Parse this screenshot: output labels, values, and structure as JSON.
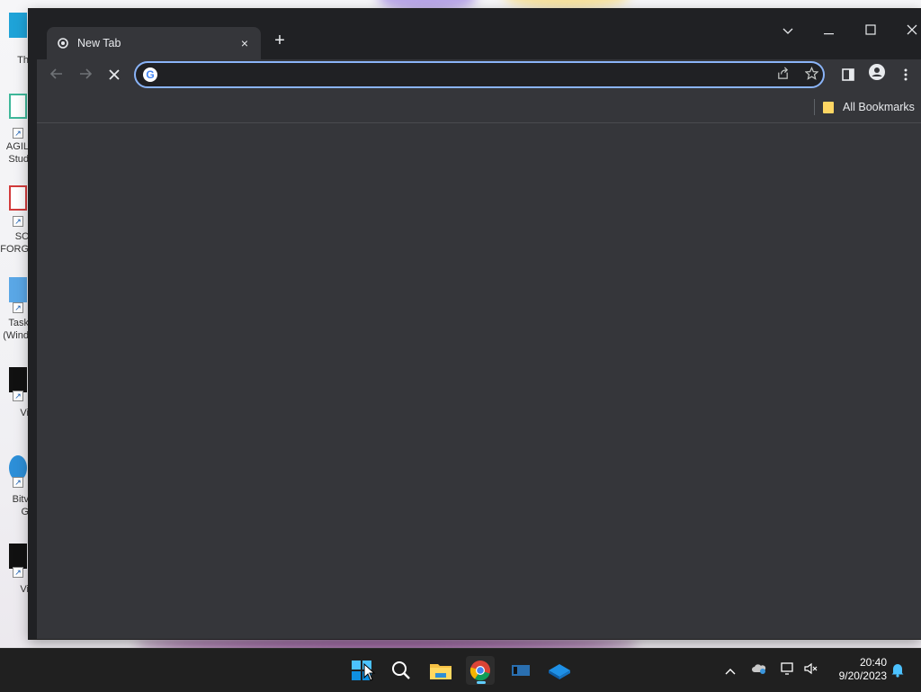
{
  "desktop": {
    "icons": [
      {
        "label": "Th"
      },
      {
        "label": "AGIL",
        "label2": "Stud"
      },
      {
        "label": "SC",
        "label2": "FORG"
      },
      {
        "label": "Task",
        "label2": "(Wind"
      },
      {
        "label": "Vi"
      },
      {
        "label": "Bitv",
        "label2": "G"
      },
      {
        "label": "Vi"
      }
    ]
  },
  "browser": {
    "tab": {
      "title": "New Tab",
      "favicon": "chrome-icon",
      "close": "×"
    },
    "new_tab_symbol": "+",
    "window_controls": {
      "tab_search": "⌄",
      "minimize": "—",
      "maximize": "☐",
      "close": "✕"
    },
    "toolbar": {
      "back": "←",
      "forward": "→",
      "stop": "✕",
      "omnibox": {
        "value": "",
        "placeholder": "",
        "engine_icon": "G"
      },
      "share_icon": "⇪",
      "star_icon": "☆",
      "side_panel_icon": "▮",
      "profile_icon": "👤",
      "menu_icon": "⋮"
    },
    "bookmarks": [
      {
        "label": "All Bookmarks",
        "icon": "folder-icon"
      }
    ]
  },
  "taskbar": {
    "apps": [
      "start-icon",
      "search-icon",
      "file-explorer-icon",
      "chrome-icon",
      "app-icon",
      "app-icon"
    ],
    "tray": {
      "chevron": "^",
      "clock_time": "20:40",
      "clock_date": "9/20/2023"
    }
  },
  "colors": {
    "window_bg": "#35363a",
    "titlebar_bg": "#202124",
    "omnibox_border": "#8ab4f8",
    "taskbar_bg": "#202020",
    "accent": "#60cdff"
  }
}
